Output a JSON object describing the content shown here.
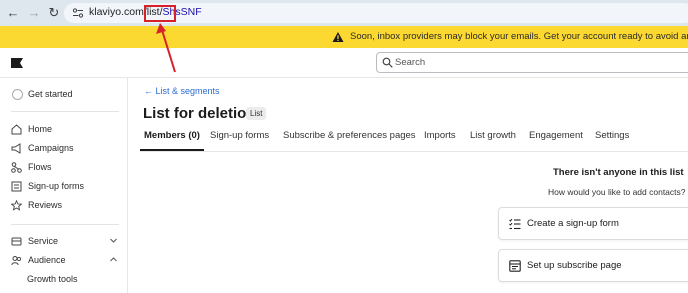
{
  "browser": {
    "url_prefix": "klaviyo.com/list/",
    "url_highlight": "ShsSNF"
  },
  "banner": {
    "text": "Soon, inbox providers may block your emails. Get your account ready to avoid any sending inter"
  },
  "header": {
    "search_placeholder": "Search"
  },
  "sidebar": {
    "get_started": "Get started",
    "items": [
      {
        "label": "Home",
        "icon": "home-icon"
      },
      {
        "label": "Campaigns",
        "icon": "megaphone-icon"
      },
      {
        "label": "Flows",
        "icon": "flows-icon"
      },
      {
        "label": "Sign-up forms",
        "icon": "form-icon"
      },
      {
        "label": "Reviews",
        "icon": "star-icon"
      }
    ],
    "service": "Service",
    "audience": "Audience",
    "growth_tools": "Growth tools"
  },
  "main": {
    "back_link": "List & segments",
    "title": "List for deletion",
    "badge": "List",
    "tabs": [
      "Members (0)",
      "Sign-up forms",
      "Subscribe & preferences pages",
      "Imports",
      "List growth",
      "Engagement",
      "Settings"
    ],
    "empty_title": "There isn't anyone in this list",
    "empty_sub": "How would you like to add contacts?",
    "cards": [
      {
        "label": "Create a sign-up form",
        "icon": "form-list-icon"
      },
      {
        "label": "Set up subscribe page",
        "icon": "page-icon"
      }
    ]
  },
  "colors": {
    "banner": "#fcd931",
    "link": "#2d6bd4",
    "annotation": "#d6202a"
  }
}
